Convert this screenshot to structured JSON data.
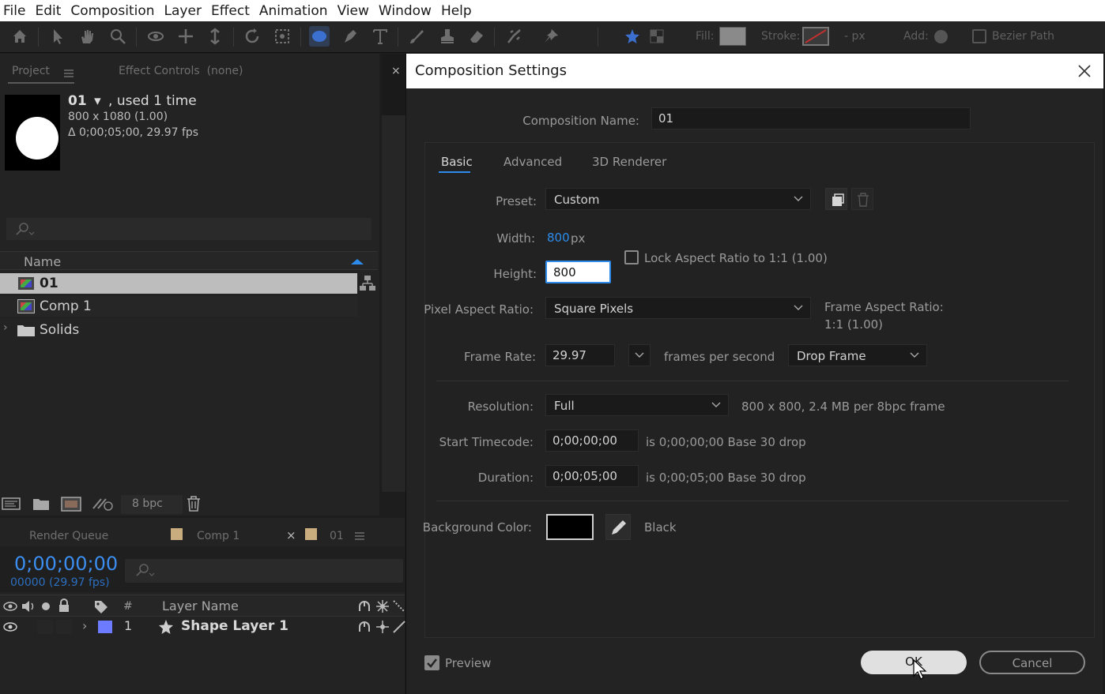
{
  "menubar": {
    "items": [
      "File",
      "Edit",
      "Composition",
      "Layer",
      "Effect",
      "Animation",
      "View",
      "Window",
      "Help"
    ]
  },
  "toolbar": {
    "fill_label": "Fill:",
    "stroke_label": "Stroke:",
    "stroke_width": "- px",
    "add_label": "Add:",
    "bezier_label": "Bezier Path"
  },
  "project": {
    "tab_project": "Project",
    "tab_effect_controls": "Effect Controls",
    "effect_controls_target": "(none)",
    "selected": {
      "name": "01",
      "used": ", used 1 time",
      "dimensions": "800 x 1080 (1.00)",
      "duration": "Δ 0;00;05;00, 29.97 fps"
    },
    "column_name": "Name",
    "items": [
      {
        "label": "01",
        "type": "comp",
        "selected": true
      },
      {
        "label": "Comp 1",
        "type": "comp",
        "selected": false
      },
      {
        "label": "Solids",
        "type": "folder",
        "selected": false
      }
    ],
    "bpc": "8 bpc"
  },
  "timeline": {
    "tab_render_queue": "Render Queue",
    "tab_comp1": "Comp 1",
    "tab_01": "01",
    "timecode": "0;00;00;00",
    "frame_info": "00000 (29.97 fps)",
    "col_num": "#",
    "col_layer_name": "Layer Name",
    "layers": [
      {
        "index": "1",
        "name": "Shape Layer 1",
        "color": "#6c7bff"
      }
    ]
  },
  "dialog": {
    "title": "Composition Settings",
    "comp_name_label": "Composition Name:",
    "comp_name_value": "01",
    "tabs": [
      "Basic",
      "Advanced",
      "3D Renderer"
    ],
    "active_tab": "Basic",
    "preset_label": "Preset:",
    "preset_value": "Custom",
    "width_label": "Width:",
    "width_value": "800",
    "width_unit": "px",
    "height_label": "Height:",
    "height_value": "800",
    "lock_aspect_label": "Lock Aspect Ratio to 1:1 (1.00)",
    "lock_aspect_checked": false,
    "par_label": "Pixel Aspect Ratio:",
    "par_value": "Square Pixels",
    "frame_aspect_label": "Frame Aspect Ratio:",
    "frame_aspect_value": "1:1 (1.00)",
    "frame_rate_label": "Frame Rate:",
    "frame_rate_value": "29.97",
    "frame_rate_unit": "frames per second",
    "drop_frame_value": "Drop Frame",
    "resolution_label": "Resolution:",
    "resolution_value": "Full",
    "resolution_info": "800 x 800, 2.4 MB per 8bpc frame",
    "start_tc_label": "Start Timecode:",
    "start_tc_value": "0;00;00;00",
    "start_tc_info": "is 0;00;00;00  Base 30  drop",
    "duration_label": "Duration:",
    "duration_value": "0;00;05;00",
    "duration_info": "is 0;00;05;00  Base 30  drop",
    "bg_color_label": "Background Color:",
    "bg_color_value": "#000000",
    "bg_color_name": "Black",
    "preview_label": "Preview",
    "preview_checked": true,
    "ok_label": "OK",
    "cancel_label": "Cancel"
  },
  "colors": {
    "accent": "#2d8ceb",
    "timecode": "#3b8ef0",
    "panel_bg": "#232323"
  }
}
